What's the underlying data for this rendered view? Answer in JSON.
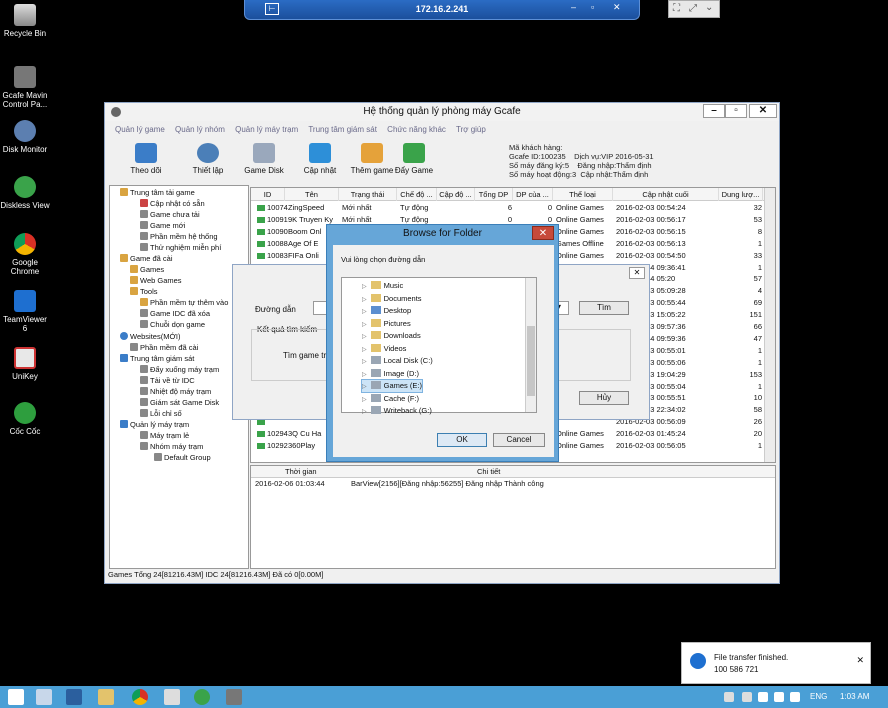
{
  "desktop_icons": [
    {
      "label": "Recycle Bin",
      "icon": "recycle-bin-icon"
    },
    {
      "label": "Gcafe Mavin Control Pa...",
      "icon": "gcafe-icon"
    },
    {
      "label": "Disk Monitor",
      "icon": "disk-monitor-icon"
    },
    {
      "label": "Diskless View",
      "icon": "diskless-view-icon"
    },
    {
      "label": "Google Chrome",
      "icon": "chrome-icon"
    },
    {
      "label": "TeamViewer 6",
      "icon": "teamviewer-icon"
    },
    {
      "label": "UniKey",
      "icon": "unikey-icon"
    },
    {
      "label": "Cốc Cốc",
      "icon": "coccoc-icon"
    }
  ],
  "remote_bar": {
    "title": "172.16.2.241"
  },
  "window": {
    "title": "Hệ thống quản lý phòng máy Gcafe",
    "menu": [
      "Quản lý game",
      "Quản lý nhóm",
      "Quản lý máy trạm",
      "Trung tâm giám sát",
      "Chức năng khác",
      "Trợ giúp"
    ],
    "toolbar": [
      "Theo dõi",
      "Thiết lập",
      "Game Disk",
      "Cập nhật",
      "Thêm game",
      "Đẩy Game"
    ],
    "info": [
      "Mã khách hàng:",
      "Gcafe ID:100235",
      "Dịch vụ:VIP 2016-05-31",
      "Số máy đăng ký:5",
      "Đăng nhập:Thẩm định",
      "Số máy hoạt động:3",
      "Cập nhật:Thẩm định"
    ],
    "tree": [
      "Trung tâm tải game",
      "Cập nhật có sẵn",
      "Game chưa tải",
      "Game mới",
      "Phần mềm hệ thống",
      "Thử nghiệm miễn phí",
      "Game đã cài",
      "Games",
      "Web Games",
      "Tools",
      "Phần mềm tự thêm vào",
      "Game IDC đã xóa",
      "Chuỗi dọn game",
      "Websites(MỚI)",
      "Phần mềm đã cài",
      "Trung tâm giám sát",
      "Đẩy xuống máy trạm",
      "Tải về từ IDC",
      "Nhiệt độ máy trạm",
      "Giám sát Game Disk",
      "Lỗi chỉ số",
      "Quản lý máy trạm",
      "Máy trạm lẻ",
      "Nhóm máy trạm",
      "Default Group"
    ],
    "grid_headers": [
      "ID",
      "Tên",
      "Trạng thái",
      "Chế độ ...",
      "Cập độ ...",
      "Tổng DP",
      "DP của ...",
      "Thể loại",
      "Cập nhật cuối",
      "Dung lượ..."
    ],
    "rows": [
      [
        "10074",
        "ZingSpeed",
        "Mới nhất",
        "Tự động",
        "",
        "6",
        "0",
        "Online Games",
        "2016-02-03 00:54:24",
        "32"
      ],
      [
        "10091",
        "9K Truyen Ky",
        "Mới nhất",
        "Tự động",
        "",
        "0",
        "0",
        "Online Games",
        "2016-02-03 00:56:17",
        "53"
      ],
      [
        "10090",
        "Boom Onl",
        "",
        "",
        "",
        "",
        "0",
        "Online Games",
        "2016-02-03 00:56:15",
        "8"
      ],
      [
        "10088",
        "Age Of E",
        "",
        "",
        "",
        "",
        "0",
        "Games Offline",
        "2016-02-03 00:56:13",
        "1"
      ],
      [
        "10083",
        "FIFa Onli",
        "",
        "",
        "",
        "",
        "0",
        "Online Games",
        "2016-02-03 00:54:50",
        "33"
      ],
      [
        "10107",
        "CCT.nh",
        "",
        "",
        "",
        "",
        "",
        "",
        "2016-02-04 09:36:41",
        "1"
      ],
      [
        "",
        "",
        "",
        "",
        "",
        "",
        "",
        "",
        "2016-02-04 05:20",
        "57"
      ],
      [
        "",
        "",
        "",
        "",
        "",
        "",
        "",
        "",
        "2016-02-03 05:09:28",
        "4"
      ],
      [
        "",
        "",
        "",
        "",
        "",
        "",
        "",
        "",
        "2016-02-03 00:55:44",
        "69"
      ],
      [
        "",
        "",
        "",
        "",
        "",
        "",
        "",
        "",
        "2016-02-03 15:05:22",
        "151"
      ],
      [
        "",
        "",
        "",
        "",
        "",
        "",
        "",
        "",
        "2016-02-03 09:57:36",
        "66"
      ],
      [
        "",
        "",
        "",
        "",
        "",
        "",
        "",
        "",
        "2016-02-04 09:59:36",
        "47"
      ],
      [
        "",
        "",
        "",
        "",
        "",
        "",
        "",
        "",
        "2016-02-03 00:55:01",
        "1"
      ],
      [
        "",
        "",
        "",
        "",
        "",
        "",
        "",
        "",
        "2016-02-03 00:55:06",
        "1"
      ],
      [
        "",
        "",
        "",
        "",
        "",
        "",
        "",
        "",
        "2016-02-03 19:04:29",
        "153"
      ],
      [
        "",
        "",
        "",
        "",
        "",
        "",
        "",
        "",
        "2016-02-03 00:55:04",
        "1"
      ],
      [
        "",
        "",
        "",
        "",
        "",
        "",
        "",
        "",
        "2016-02-03 00:55:51",
        "10"
      ],
      [
        "",
        "",
        "",
        "",
        "",
        "",
        "",
        "",
        "2016-02-03 22:34:02",
        "58"
      ],
      [
        "",
        "",
        "",
        "",
        "",
        "",
        "",
        "",
        "2016-02-03 00:56:09",
        "26"
      ],
      [
        "10294",
        "3Q Cu Ha",
        "",
        "",
        "",
        "",
        "0",
        "Online Games",
        "2016-02-03 01:45:24",
        "20"
      ],
      [
        "10292",
        "360Play",
        "",
        "",
        "",
        "",
        "0",
        "Online Games",
        "2016-02-03 00:56:05",
        "1"
      ]
    ],
    "log_headers": [
      "Thời gian",
      "Chi tiết"
    ],
    "log_rows": [
      [
        "2016-02-06 01:03:44",
        "BarView[2156][Đăng nhập:56255] Đăng nhập Thành công"
      ]
    ],
    "status": "Games Tổng 24[81216.43M] IDC 24[81216.43M] Đã có 0[0.00M]"
  },
  "search_dialog": {
    "path_label": "Đường dẫn",
    "result_label": "Kết quả tìm kiếm",
    "game_label": "Tìm game trùn",
    "find_button": "Tìm",
    "cancel_button": "Hủy"
  },
  "browse_dialog": {
    "title": "Browse for Folder",
    "prompt": "Vui lòng chọn đường dẫn",
    "folders": [
      "Music",
      "Documents",
      "Desktop",
      "Pictures",
      "Downloads",
      "Videos",
      "Local Disk (C:)",
      "Image (D:)",
      "Games (E:)",
      "Cache (F:)",
      "Writeback (G:)"
    ],
    "selected": "Games (E:)",
    "ok": "OK",
    "cancel": "Cancel"
  },
  "notification": {
    "title": "File transfer finished.",
    "id": "100 586 721"
  },
  "taskbar": {
    "lang": "ENG",
    "time": "1:03 AM"
  }
}
